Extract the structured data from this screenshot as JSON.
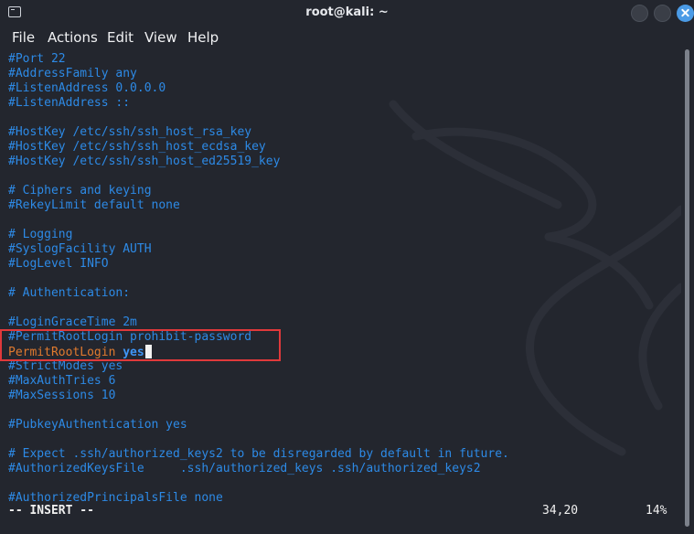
{
  "window": {
    "title": "root@kali: ~"
  },
  "menu": {
    "items": [
      "File",
      "Actions",
      "Edit",
      "View",
      "Help"
    ]
  },
  "editor": {
    "lines": [
      "#Port 22",
      "#AddressFamily any",
      "#ListenAddress 0.0.0.0",
      "#ListenAddress ::",
      "",
      "#HostKey /etc/ssh/ssh_host_rsa_key",
      "#HostKey /etc/ssh/ssh_host_ecdsa_key",
      "#HostKey /etc/ssh/ssh_host_ed25519_key",
      "",
      "# Ciphers and keying",
      "#RekeyLimit default none",
      "",
      "# Logging",
      "#SyslogFacility AUTH",
      "#LogLevel INFO",
      "",
      "# Authentication:",
      "",
      "#LoginGraceTime 2m",
      "#PermitRootLogin prohibit-password",
      "",
      "#StrictModes yes",
      "#MaxAuthTries 6",
      "#MaxSessions 10",
      "",
      "#PubkeyAuthentication yes",
      "",
      "# Expect .ssh/authorized_keys2 to be disregarded by default in future.",
      "#AuthorizedKeysFile     .ssh/authorized_keys .ssh/authorized_keys2",
      "",
      "#AuthorizedPrincipalsFile none"
    ],
    "edited_line": {
      "keyword": "PermitRootLogin",
      "value": "yes"
    }
  },
  "status": {
    "mode": "-- INSERT --",
    "position": "34,20",
    "percent": "14%"
  },
  "colors": {
    "background": "#23262e",
    "comment": "#2d8ae6",
    "keyword": "#e07a2e",
    "value": "#3e95f5",
    "highlight_box": "#e0393b",
    "close_button": "#4b9be6"
  }
}
